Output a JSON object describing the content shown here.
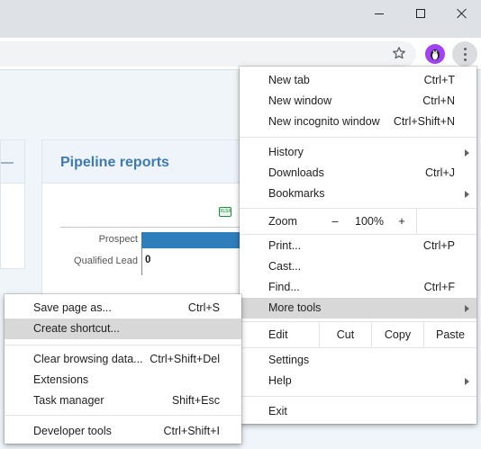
{
  "browser": {
    "window_controls": {
      "minimize": "minimize",
      "maximize": "maximize",
      "close": "close"
    },
    "profile_initial": "🐧"
  },
  "page": {
    "card_title": "Pipeline reports",
    "export_label": "XLSX",
    "chart_data": {
      "type": "bar",
      "orientation": "horizontal",
      "categories": [
        "Prospect",
        "Qualified Lead"
      ],
      "values": [
        null,
        0
      ],
      "value_labels": [
        "",
        "0"
      ]
    }
  },
  "main_menu": {
    "new_tab": {
      "label": "New tab",
      "shortcut": "Ctrl+T"
    },
    "new_window": {
      "label": "New window",
      "shortcut": "Ctrl+N"
    },
    "new_incognito": {
      "label": "New incognito window",
      "shortcut": "Ctrl+Shift+N"
    },
    "history": {
      "label": "History"
    },
    "downloads": {
      "label": "Downloads",
      "shortcut": "Ctrl+J"
    },
    "bookmarks": {
      "label": "Bookmarks"
    },
    "zoom": {
      "label": "Zoom",
      "minus": "–",
      "level": "100%",
      "plus": "+"
    },
    "print": {
      "label": "Print...",
      "shortcut": "Ctrl+P"
    },
    "cast": {
      "label": "Cast..."
    },
    "find": {
      "label": "Find...",
      "shortcut": "Ctrl+F"
    },
    "more_tools": {
      "label": "More tools"
    },
    "edit": {
      "label": "Edit",
      "cut": "Cut",
      "copy": "Copy",
      "paste": "Paste"
    },
    "settings": {
      "label": "Settings"
    },
    "help": {
      "label": "Help"
    },
    "exit": {
      "label": "Exit"
    }
  },
  "sub_menu": {
    "save_page": {
      "label": "Save page as...",
      "shortcut": "Ctrl+S"
    },
    "create_shortcut": {
      "label": "Create shortcut..."
    },
    "clear_browsing": {
      "label": "Clear browsing data...",
      "shortcut": "Ctrl+Shift+Del"
    },
    "extensions": {
      "label": "Extensions"
    },
    "task_manager": {
      "label": "Task manager",
      "shortcut": "Shift+Esc"
    },
    "developer_tools": {
      "label": "Developer tools",
      "shortcut": "Ctrl+Shift+I"
    }
  }
}
